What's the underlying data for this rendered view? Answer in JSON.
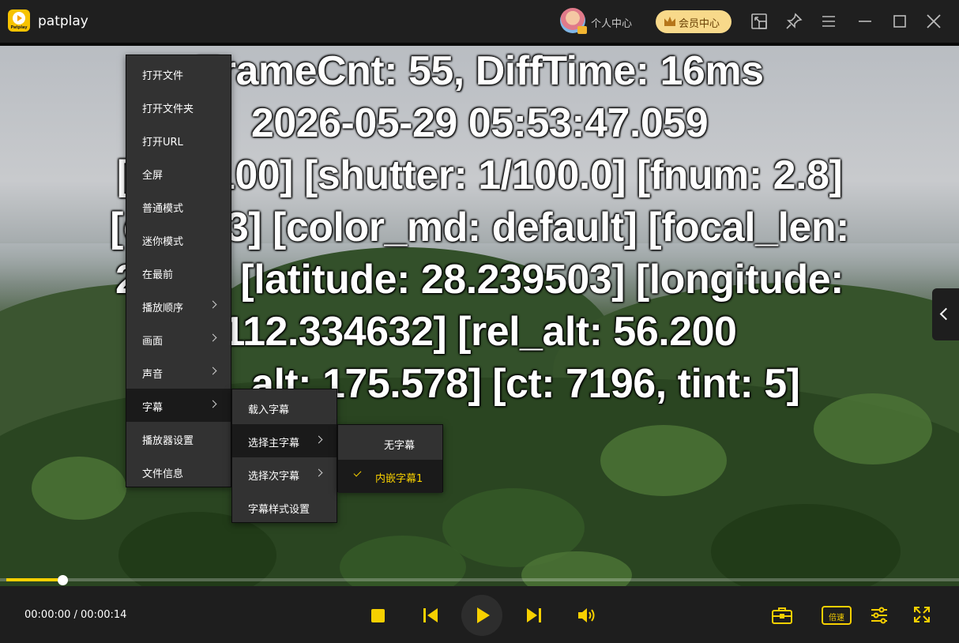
{
  "app": {
    "name": "patplay",
    "logo_text": "Patplay"
  },
  "header": {
    "user_center": "个人中心",
    "vip_center": "会员中心"
  },
  "overlay": {
    "lines": [
      "FrameCnt: 55, DiffTime: 16ms",
      "2026-05-29 05:53:47.059",
      "[iso: 100] [shutter: 1/100.0] [fnum: 2.8]",
      "[ev: 0.3] [color_md: default] [focal_len:",
      "28.00] [latitude: 28.239503] [longitude:",
      "112.334632] [rel_alt: 56.200",
      "abs_alt: 175.578] [ct: 7196, tint: 5]"
    ]
  },
  "context_menu": {
    "items": [
      {
        "label": "打开文件",
        "submenu": false
      },
      {
        "label": "打开文件夹",
        "submenu": false
      },
      {
        "label": "打开URL",
        "submenu": false
      },
      {
        "label": "全屏",
        "submenu": false
      },
      {
        "label": "普通模式",
        "submenu": false
      },
      {
        "label": "迷你模式",
        "submenu": false
      },
      {
        "label": "在最前",
        "submenu": false
      },
      {
        "label": "播放顺序",
        "submenu": true
      },
      {
        "label": "画面",
        "submenu": true
      },
      {
        "label": "声音",
        "submenu": true
      },
      {
        "label": "字幕",
        "submenu": true,
        "active": true
      },
      {
        "label": "播放器设置",
        "submenu": false
      },
      {
        "label": "文件信息",
        "submenu": false
      }
    ]
  },
  "subtitle_menu": {
    "items": [
      {
        "label": "载入字幕",
        "submenu": false
      },
      {
        "label": "选择主字幕",
        "submenu": true,
        "active": true
      },
      {
        "label": "选择次字幕",
        "submenu": true
      },
      {
        "label": "字幕样式设置",
        "submenu": false
      }
    ]
  },
  "main_subtitle_menu": {
    "items": [
      {
        "label": "无字幕",
        "selected": false
      },
      {
        "label": "内嵌字幕1",
        "selected": true
      }
    ]
  },
  "player": {
    "time": "00:00:00 / 00:00:14",
    "progress": 0.06,
    "speed_label": "倍速"
  },
  "colors": {
    "accent": "#f7d000",
    "vip": "#f8d98a",
    "menu_bg": "#323232"
  },
  "icons": [
    "screen-icon",
    "pin-icon",
    "menu-icon",
    "minimize-icon",
    "maximize-icon",
    "close-icon",
    "stop-icon",
    "previous-icon",
    "play-icon",
    "next-icon",
    "volume-icon",
    "toolbox-icon",
    "settings-sliders-icon",
    "fullscreen-icon"
  ]
}
